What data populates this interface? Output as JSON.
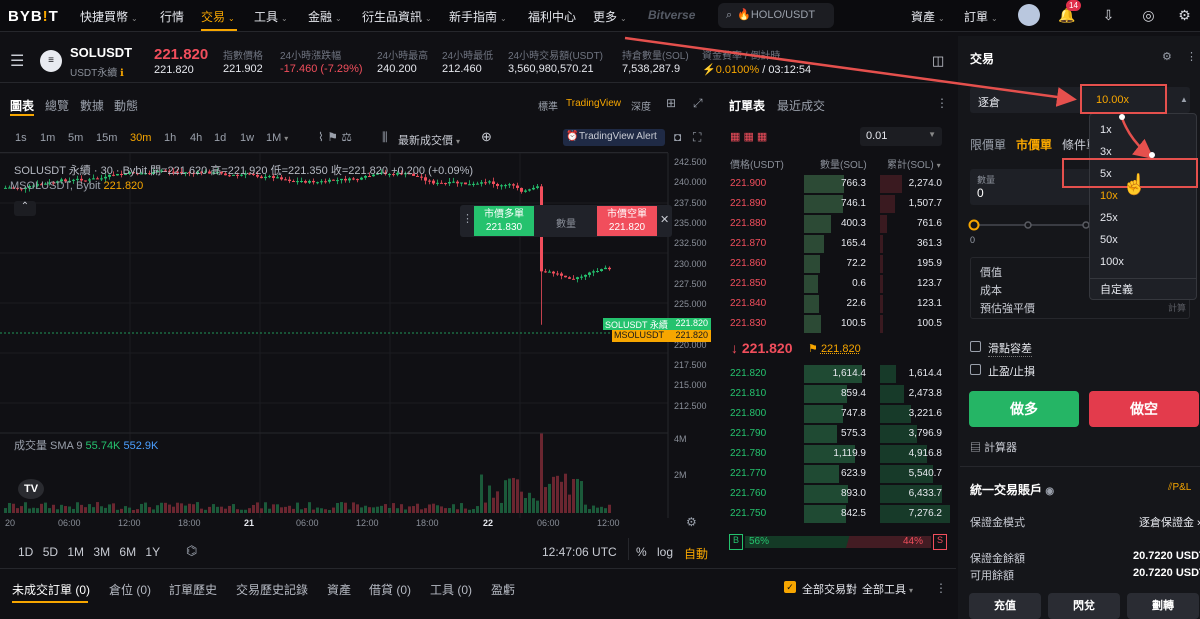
{
  "nav": {
    "logo_text": "BYB",
    "logo_dot": "!",
    "logo_end": "T",
    "items": [
      "快捷買幣",
      "行情",
      "交易",
      "工具",
      "金融",
      "衍生品資訊",
      "新手指南",
      "福利中心",
      "更多"
    ],
    "brand_extra": "Bitverse",
    "search_text": "🔥HOLO/USDT",
    "assets": "資產",
    "orders": "訂單",
    "bell_count": "14"
  },
  "ticker": {
    "symbol": "SOLUSDT",
    "sub": "USDT永續",
    "price": "221.820",
    "price_sub": "221.820",
    "index_label": "指數價格",
    "index_val": "221.902",
    "chg_label": "24小時漲跌幅",
    "chg_val": "-17.460 (-7.29%)",
    "high_label": "24小時最高",
    "high_val": "240.200",
    "low_label": "24小時最低",
    "low_val": "212.460",
    "turn_label": "24小時交易額(USDT)",
    "turn_val": "3,560,980,570.21",
    "oi_label": "持倉數量(SOL)",
    "oi_val": "7,538,287.9",
    "fund_label": "資金費率 / 倒計時",
    "fund_rate": "0.0100%",
    "fund_time": "/ 03:12:54"
  },
  "chart_tabs": {
    "items": [
      "圖表",
      "總覽",
      "數據",
      "動態"
    ],
    "right": [
      "標準",
      "TradingView",
      "深度"
    ]
  },
  "timeframes": [
    "1s",
    "1m",
    "5m",
    "15m",
    "30m",
    "1h",
    "4h",
    "1d",
    "1w",
    "1M"
  ],
  "chart_toolbar": {
    "latest": "最新成交價",
    "alert": "TradingView Alert"
  },
  "chart_header": {
    "line1": "SOLUSDT 永續 · 30 · Bybit  開=221.620 高=221.920 低=221.350 收=221.820 +0.200 (+0.09%)",
    "line2_label": "MSOLUSDT, Bybit",
    "line2_val": "221.820"
  },
  "quick_trade": {
    "buy_label": "市價多單",
    "buy_price": "221.830",
    "qty_label": "數量",
    "sell_label": "市價空單",
    "sell_price": "221.820"
  },
  "price_axis": [
    "242.500",
    "240.000",
    "237.500",
    "235.000",
    "232.500",
    "230.000",
    "227.500",
    "225.000",
    "222.500",
    "220.000",
    "217.500",
    "215.000",
    "212.500"
  ],
  "price_tags": {
    "sol_label": "SOLUSDT 永續",
    "sol_val": "221.820",
    "msol_label": "MSOLUSDT",
    "msol_val": "221.820"
  },
  "volume": {
    "label": "成交量 SMA 9",
    "v1": "55.74K",
    "v2": "552.9K",
    "axis1": "4M",
    "axis2": "2M"
  },
  "x_axis": [
    "20",
    "06:00",
    "12:00",
    "18:00",
    "21",
    "06:00",
    "12:00",
    "18:00",
    "22",
    "06:00",
    "12:00"
  ],
  "range_buttons": [
    "1D",
    "5D",
    "1M",
    "3M",
    "6M",
    "1Y"
  ],
  "chart_footer": {
    "time": "12:47:06 UTC",
    "pct": "%",
    "log": "log",
    "auto": "自動"
  },
  "orderbook": {
    "tabs": [
      "訂單表",
      "最近成交"
    ],
    "step": "0.01",
    "headers": [
      "價格(USDT)",
      "數量(SOL)",
      "累計(SOL)"
    ],
    "asks": [
      [
        "221.900",
        "766.3",
        "2,274.0"
      ],
      [
        "221.890",
        "746.1",
        "1,507.7"
      ],
      [
        "221.880",
        "400.3",
        "761.6"
      ],
      [
        "221.870",
        "165.4",
        "361.3"
      ],
      [
        "221.860",
        "72.2",
        "195.9"
      ],
      [
        "221.850",
        "0.6",
        "123.7"
      ],
      [
        "221.840",
        "22.6",
        "123.1"
      ],
      [
        "221.830",
        "100.5",
        "100.5"
      ]
    ],
    "last": "↓ 221.820",
    "mark": "221.820",
    "bids": [
      [
        "221.820",
        "1,614.4",
        "1,614.4"
      ],
      [
        "221.810",
        "859.4",
        "2,473.8"
      ],
      [
        "221.800",
        "747.8",
        "3,221.6"
      ],
      [
        "221.790",
        "575.3",
        "3,796.9"
      ],
      [
        "221.780",
        "1,119.9",
        "4,916.8"
      ],
      [
        "221.770",
        "623.9",
        "5,540.7"
      ],
      [
        "221.760",
        "893.0",
        "6,433.7"
      ],
      [
        "221.750",
        "842.5",
        "7,276.2"
      ]
    ],
    "buy_pct": "56%",
    "sell_pct": "44%",
    "buy_tag": "B",
    "sell_tag": "S"
  },
  "trade": {
    "title": "交易",
    "margin_mode": "逐倉",
    "leverage": "10.00x",
    "order_types": [
      "限價單",
      "市價單",
      "條件單"
    ],
    "qty_label": "數量",
    "qty_val": "0",
    "slider_min": "0",
    "value_label": "價值",
    "cost_label": "成本",
    "liq_label": "預估強平價",
    "calc_hint": "計算",
    "slippage": "滑點容差",
    "tpsl": "止盈/止損",
    "long": "做多",
    "short": "做空",
    "calculator": "計算器",
    "account_title": "統一交易賬戶",
    "pnl": "P&L",
    "margin_mode_label": "保證金模式",
    "margin_mode_val": "逐倉保證金",
    "balance_label": "保證金餘額",
    "balance_val": "20.7220 USDT",
    "avail_label": "可用餘額",
    "avail_val": "20.7220 USDT",
    "deposit": "充值",
    "convert": "閃兌",
    "transfer": "劃轉"
  },
  "leverage_dropdown": [
    "1x",
    "3x",
    "5x",
    "10x",
    "25x",
    "50x",
    "100x",
    "自定義"
  ],
  "bottom_tabs": [
    "未成交訂單 (0)",
    "倉位 (0)",
    "訂單歷史",
    "交易歷史記錄",
    "資產",
    "借貸 (0)",
    "工具 (0)",
    "盈虧"
  ],
  "bottom_right": {
    "all_pairs": "全部交易對",
    "all_tools": "全部工具"
  }
}
